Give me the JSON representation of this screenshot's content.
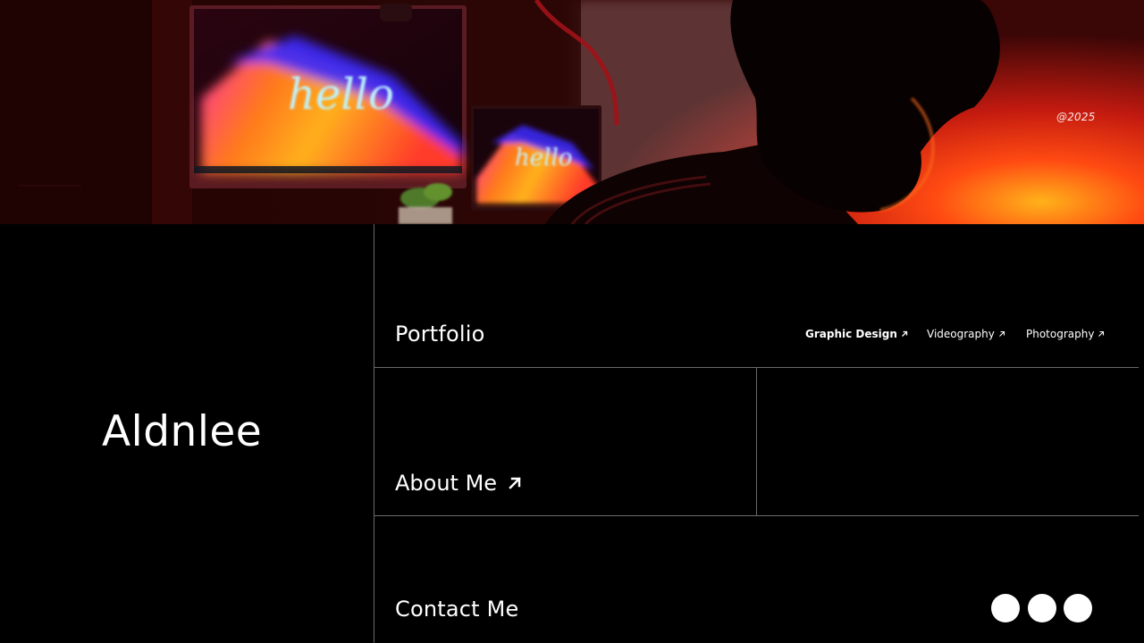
{
  "hero": {
    "year_label": "@2025",
    "monitor_text": "hello",
    "monitor_small_text": "hello"
  },
  "brand": {
    "name": "Aldnlee"
  },
  "portfolio": {
    "title": "Portfolio",
    "categories": [
      {
        "label": "Graphic Design",
        "active": true
      },
      {
        "label": "Videography",
        "active": false
      },
      {
        "label": "Photography",
        "active": false
      }
    ]
  },
  "about": {
    "label": "About Me"
  },
  "contact": {
    "title": "Contact Me",
    "social_buttons": [
      "social-link-1",
      "social-link-2",
      "social-link-3"
    ]
  },
  "colors": {
    "background": "#000000",
    "divider": "#6a6a6a",
    "text": "#ffffff"
  }
}
